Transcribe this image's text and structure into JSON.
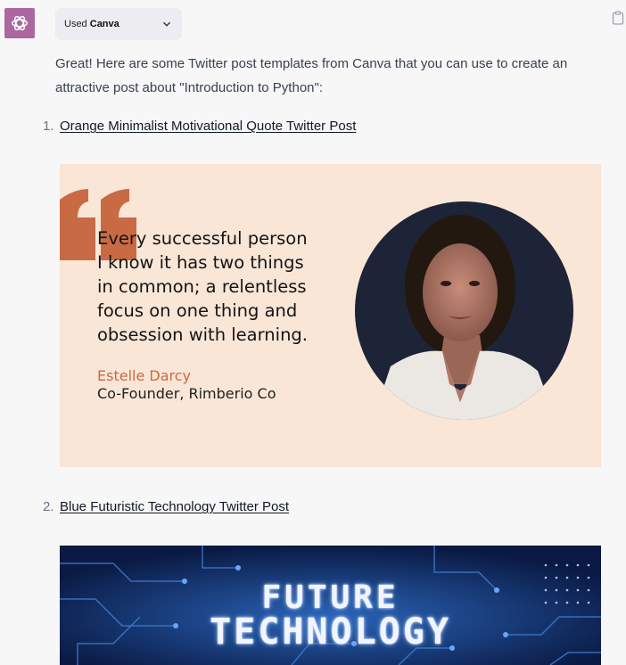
{
  "header": {
    "plugin_prefix": "Used",
    "plugin_name": "Canva"
  },
  "message": {
    "intro": "Great! Here are some Twitter post templates from Canva that you can use to create an attractive post about \"Introduction to Python\":"
  },
  "templates": [
    {
      "number": "1.",
      "title": "Orange Minimalist Motivational Quote Twitter Post",
      "quote_lines": [
        "Every successful person",
        "I know it has two things",
        "in common; a relentless",
        "focus on one thing and",
        "obsession with learning."
      ],
      "author_name": "Estelle Darcy",
      "author_role": "Co-Founder, Rimberio Co",
      "accent_color": "#c86b44",
      "background_color": "#f9e6d7"
    },
    {
      "number": "2.",
      "title": "Blue Futuristic Technology Twitter Post",
      "headline_line1": "FUTURE",
      "headline_line2": "TECHNOLOGY",
      "background_color": "#0b1d4a"
    }
  ],
  "icons": {
    "avatar": "chatgpt-logo-icon",
    "dropdown": "chevron-down-icon",
    "copy": "clipboard-icon"
  }
}
